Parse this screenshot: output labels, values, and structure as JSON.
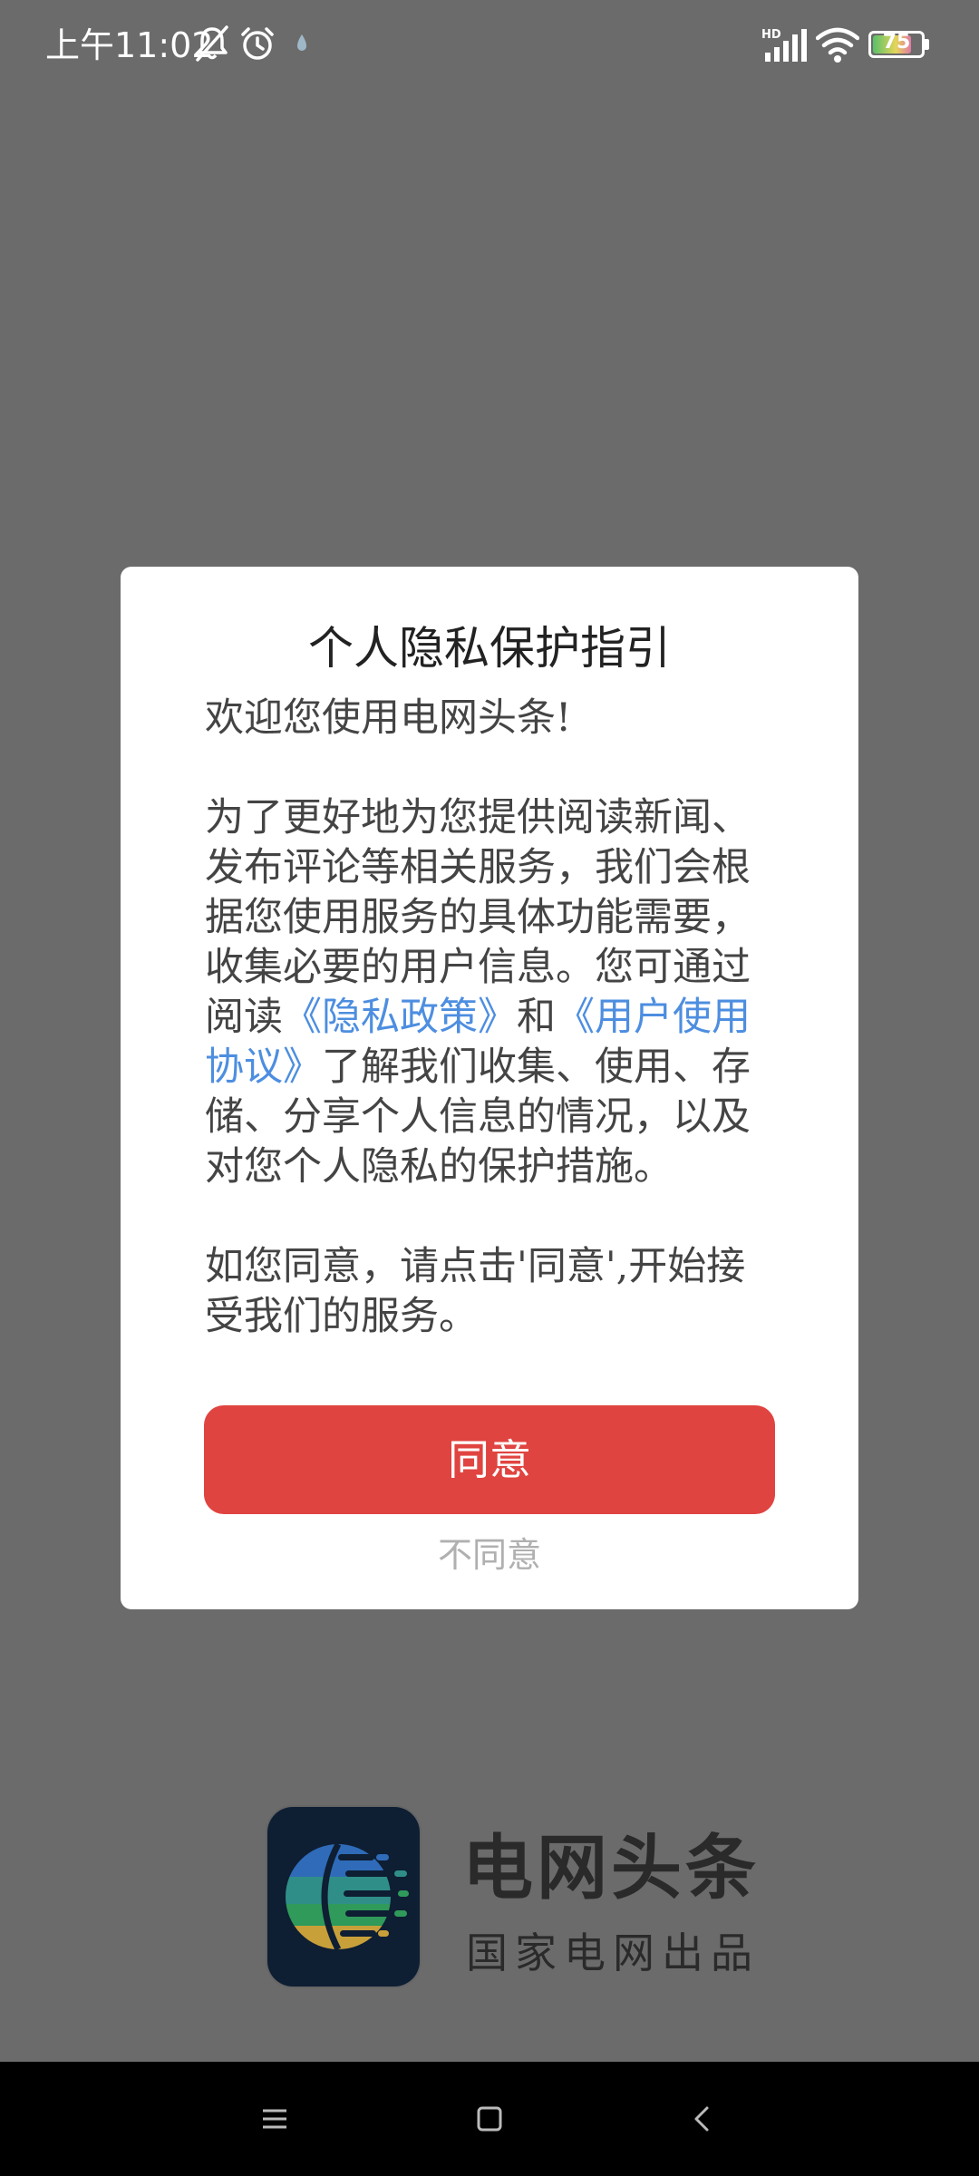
{
  "status_bar": {
    "time": "上午11:02",
    "battery_level": "75",
    "signal_label": "HD"
  },
  "dialog": {
    "title": "个人隐私保护指引",
    "greeting": "欢迎您使用电网头条!",
    "para1_part1": "为了更好地为您提供阅读新闻、发布评论等相关服务，我们会根据您使用服务的具体功能需要，收集必要的用户信息。您可通过阅读",
    "privacy_link": "《隐私政策》",
    "and_text": "和",
    "terms_link": "《用户使用协议》",
    "para1_part2": "了解我们收集、使用、存储、分享个人信息的情况，以及对您个人隐私的保护措施。",
    "para2": "如您同意，请点击'同意',开始接受我们的服务。",
    "agree_label": "同意",
    "disagree_label": "不同意"
  },
  "branding": {
    "app_name": "电网头条",
    "tagline": "国家电网出品"
  },
  "nav_bar": {
    "icons": [
      "menu-icon",
      "home-icon",
      "back-icon"
    ]
  },
  "colors": {
    "accent": "#e04440",
    "link": "#4d8ee0",
    "overlay": "#6b6b6b"
  }
}
